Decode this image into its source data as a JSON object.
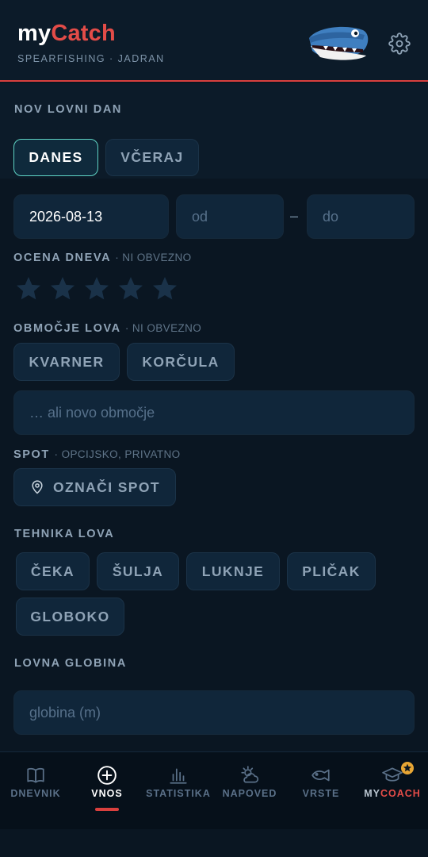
{
  "header": {
    "brand_my": "my",
    "brand_catch": "Catch",
    "subtitle": "SPEARFISHING · JADRAN"
  },
  "new_day": {
    "title": "NOV LOVNI DAN",
    "day_tabs": [
      {
        "label": "DANES",
        "active": true
      },
      {
        "label": "VČERAJ",
        "active": false
      }
    ]
  },
  "date": {
    "value": "2026-08-13",
    "from_placeholder": "od",
    "separator": "–",
    "to_placeholder": "do"
  },
  "rating": {
    "label": "OCENA DNEVA",
    "optional": "· NI OBVEZNO",
    "max": 5,
    "value": 0
  },
  "area": {
    "label": "OBMOČJE LOVA",
    "optional": "· NI OBVEZNO",
    "chips": [
      "KVARNER",
      "KORČULA"
    ],
    "new_placeholder": "… ali novo območje"
  },
  "spot": {
    "label": "SPOT",
    "optional": "· OPCIJSKO, PRIVATNO",
    "button": "OZNAČI SPOT"
  },
  "technique": {
    "label": "TEHNIKA LOVA",
    "chips": [
      "ČEKA",
      "ŠULJA",
      "LUKNJE",
      "PLIČAK",
      "GLOBOKO"
    ]
  },
  "depth": {
    "label": "LOVNA GLOBINA",
    "placeholder": "globina (m)"
  },
  "nav": [
    {
      "label": "DNEVNIK",
      "icon": "book-icon"
    },
    {
      "label": "VNOS",
      "icon": "plus-circle-icon",
      "active": true
    },
    {
      "label": "STATISTIKA",
      "icon": "bar-chart-icon"
    },
    {
      "label": "NAPOVED",
      "icon": "weather-icon"
    },
    {
      "label": "VRSTE",
      "icon": "fish-icon"
    },
    {
      "label_my": "MY",
      "label_coach": "COACH",
      "icon": "graduation-cap-icon"
    }
  ],
  "colors": {
    "accent_red": "#e34c48",
    "active_border": "#5fd3c4",
    "badge": "#e8a634"
  }
}
